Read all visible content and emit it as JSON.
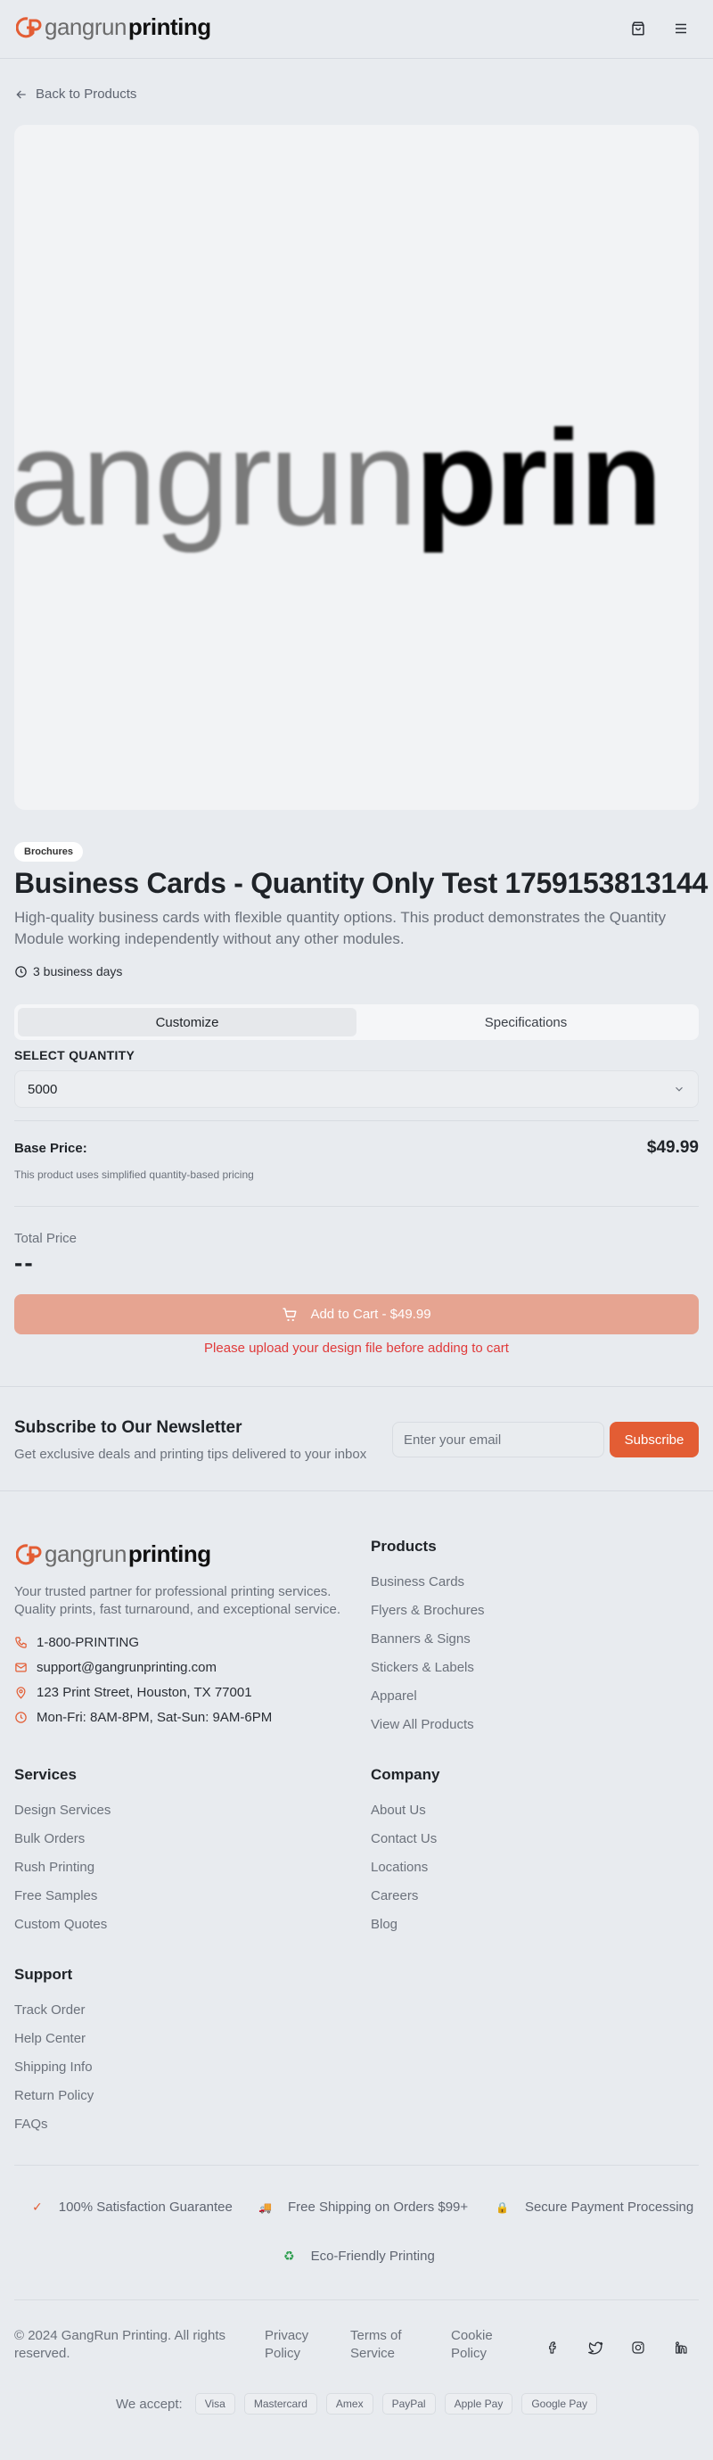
{
  "header": {
    "logo_prefix": "gangrun",
    "logo_suffix": "printing",
    "cart_icon": "shopping-bag-icon",
    "menu_icon": "hamburger-menu-icon"
  },
  "nav": {
    "back_label": "Back to Products"
  },
  "hero_image": {
    "text_prefix": "angrun",
    "text_suffix": "prin"
  },
  "product": {
    "category": "Brochures",
    "title": "Business Cards - Quantity Only Test 1759153813144",
    "description": "High-quality business cards with flexible quantity options. This product demonstrates the Quantity Module working independently without any other modules.",
    "turnaround": "3 business days",
    "tabs": [
      {
        "label": "Customize",
        "active": true
      },
      {
        "label": "Specifications",
        "active": false
      }
    ],
    "quantity_label": "SELECT QUANTITY",
    "quantity_value": "5000",
    "base_price_label": "Base Price:",
    "base_price": "$49.99",
    "pricing_note": "This product uses simplified quantity-based pricing",
    "total_label": "Total Price",
    "total_value": "--",
    "add_to_cart": "Add to Cart - $49.99",
    "upload_warning": "Please upload your design file before adding to cart"
  },
  "newsletter": {
    "title": "Subscribe to Our Newsletter",
    "subtitle": "Get exclusive deals and printing tips delivered to your inbox",
    "placeholder": "Enter your email",
    "button": "Subscribe"
  },
  "footer": {
    "logo_prefix": "gangrun",
    "logo_suffix": "printing",
    "description": "Your trusted partner for professional printing services. Quality prints, fast turnaround, and exceptional service.",
    "contact": {
      "phone": "1-800-PRINTING",
      "email": "support@gangrunprinting.com",
      "address": "123 Print Street, Houston, TX 77001",
      "hours": "Mon-Fri: 8AM-8PM, Sat-Sun: 9AM-6PM"
    },
    "products": {
      "title": "Products",
      "links": [
        "Business Cards",
        "Flyers & Brochures",
        "Banners & Signs",
        "Stickers & Labels",
        "Apparel",
        "View All Products"
      ]
    },
    "services": {
      "title": "Services",
      "links": [
        "Design Services",
        "Bulk Orders",
        "Rush Printing",
        "Free Samples",
        "Custom Quotes"
      ]
    },
    "company": {
      "title": "Company",
      "links": [
        "About Us",
        "Contact Us",
        "Locations",
        "Careers",
        "Blog"
      ]
    },
    "support": {
      "title": "Support",
      "links": [
        "Track Order",
        "Help Center",
        "Shipping Info",
        "Return Policy",
        "FAQs"
      ]
    },
    "trust": [
      {
        "icon": "check-icon",
        "glyph": "✓",
        "color": "#e35d34",
        "label": "100% Satisfaction Guarantee"
      },
      {
        "icon": "truck-icon",
        "glyph": "🚚",
        "color": "#e35d34",
        "label": "Free Shipping on Orders $99+"
      },
      {
        "icon": "lock-icon",
        "glyph": "🔒",
        "color": "#d4a017",
        "label": "Secure Payment Processing"
      },
      {
        "icon": "recycle-icon",
        "glyph": "♻",
        "color": "#2e9e4f",
        "label": "Eco-Friendly Printing"
      }
    ],
    "copyright": "© 2024 GangRun Printing. All rights reserved.",
    "legal": [
      "Privacy Policy",
      "Terms of Service",
      "Cookie Policy"
    ],
    "social_icons": [
      "facebook-icon",
      "twitter-icon",
      "instagram-icon",
      "linkedin-icon"
    ],
    "payments_label": "We accept:",
    "payments": [
      "Visa",
      "Mastercard",
      "Amex",
      "PayPal",
      "Apple Pay",
      "Google Pay"
    ]
  },
  "colors": {
    "accent": "#e35d34",
    "accent_disabled": "#e6a491",
    "warning": "#e03a3a",
    "background": "#e8ebef"
  }
}
